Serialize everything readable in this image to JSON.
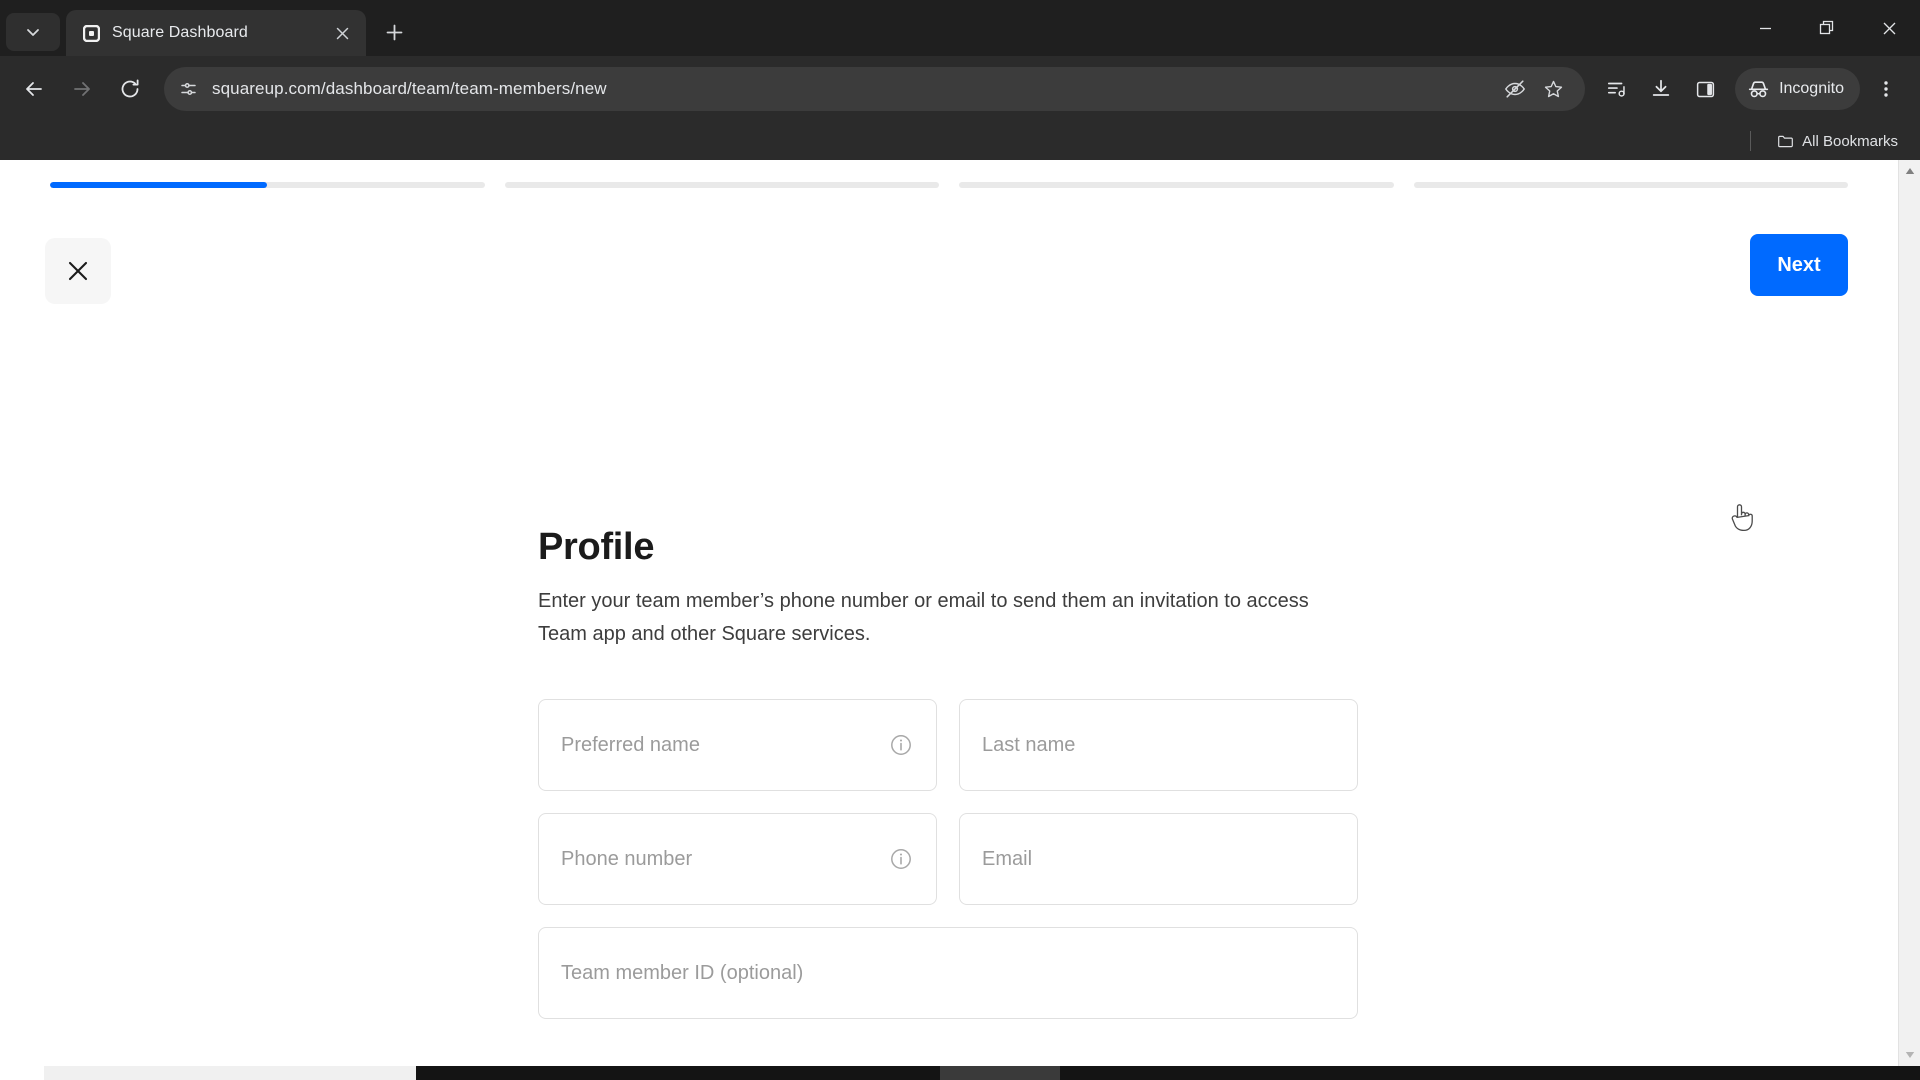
{
  "browser": {
    "tab": {
      "title": "Square Dashboard",
      "favicon_icon": "square-logo-icon",
      "close_icon": "close-icon"
    },
    "tab_search_icon": "chevron-down-icon",
    "new_tab_icon": "plus-icon",
    "window_controls": {
      "minimize_icon": "minimize-icon",
      "maximize_icon": "restore-window-icon",
      "close_icon": "close-window-icon"
    },
    "nav": {
      "back_icon": "arrow-left-icon",
      "forward_icon": "arrow-right-icon",
      "reload_icon": "reload-icon"
    },
    "omnibox": {
      "site_info_icon": "page-settings-icon",
      "url": "squareup.com/dashboard/team/team-members/new",
      "tracking_protection_icon": "eye-slash-icon",
      "bookmark_icon": "star-icon"
    },
    "toolbar": {
      "reading_list_icon": "reading-list-icon",
      "downloads_icon": "download-icon",
      "side_panel_icon": "side-panel-icon",
      "incognito_icon": "incognito-icon",
      "incognito_label": "Incognito",
      "menu_icon": "three-dot-menu-icon"
    },
    "bookmarks_bar": {
      "folder_icon": "folder-icon",
      "all_bookmarks_label": "All Bookmarks"
    }
  },
  "page": {
    "progress": {
      "steps": [
        {
          "fill_percent": 50
        },
        {
          "fill_percent": 0
        },
        {
          "fill_percent": 0
        },
        {
          "fill_percent": 0
        }
      ],
      "active_color": "#006aff",
      "track_color": "#e9e9e9"
    },
    "close_button": {
      "icon": "close-icon"
    },
    "next_button": {
      "label": "Next",
      "color": "#006aff"
    },
    "title": "Profile",
    "description": "Enter your team member’s phone number or email to send them an invitation to access Team app and other Square services.",
    "fields": [
      {
        "name": "preferred-name",
        "placeholder": "Preferred name",
        "value": "",
        "has_info_icon": true,
        "info_icon": "info-icon"
      },
      {
        "name": "last-name",
        "placeholder": "Last name",
        "value": "",
        "has_info_icon": false
      },
      {
        "name": "phone-number",
        "placeholder": "Phone number",
        "value": "",
        "has_info_icon": true,
        "info_icon": "info-icon"
      },
      {
        "name": "email",
        "placeholder": "Email",
        "value": "",
        "has_info_icon": false
      },
      {
        "name": "team-member-id",
        "placeholder": "Team member ID (optional)",
        "value": "",
        "has_info_icon": false
      }
    ],
    "scrollbar": {
      "up_arrow_icon": "scroll-up-arrow-icon",
      "down_arrow_icon": "scroll-down-arrow-icon"
    },
    "cursor": {
      "icon": "pointer-hand-cursor"
    }
  }
}
